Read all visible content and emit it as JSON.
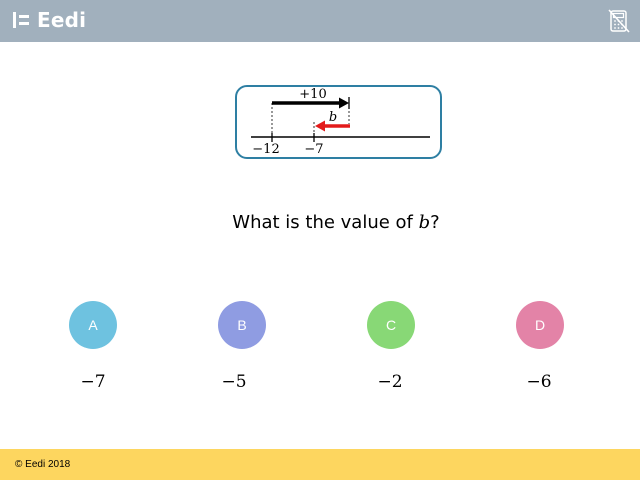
{
  "header": {
    "brand": "Eedi",
    "calculator_icon": "no-calculator-icon",
    "background": "#a1b0bd"
  },
  "diagram": {
    "top_label": "+10",
    "arrow_label": "b",
    "tick_labels": [
      "−12",
      "−7"
    ],
    "arrow_color_main": "#000000",
    "arrow_color_b": "#e31b1b",
    "border_color": "#2e7fa3"
  },
  "question": {
    "prefix": "What is the value of ",
    "variable": "b",
    "suffix": "?"
  },
  "options": [
    {
      "letter": "A",
      "answer": "−7",
      "color": "#6ec2e0"
    },
    {
      "letter": "B",
      "answer": "−5",
      "color": "#8f9ce2"
    },
    {
      "letter": "C",
      "answer": "−2",
      "color": "#88d876"
    },
    {
      "letter": "D",
      "answer": "−6",
      "color": "#e383a7"
    }
  ],
  "footer": {
    "copyright": "© Eedi 2018",
    "background": "#fdd65f"
  }
}
